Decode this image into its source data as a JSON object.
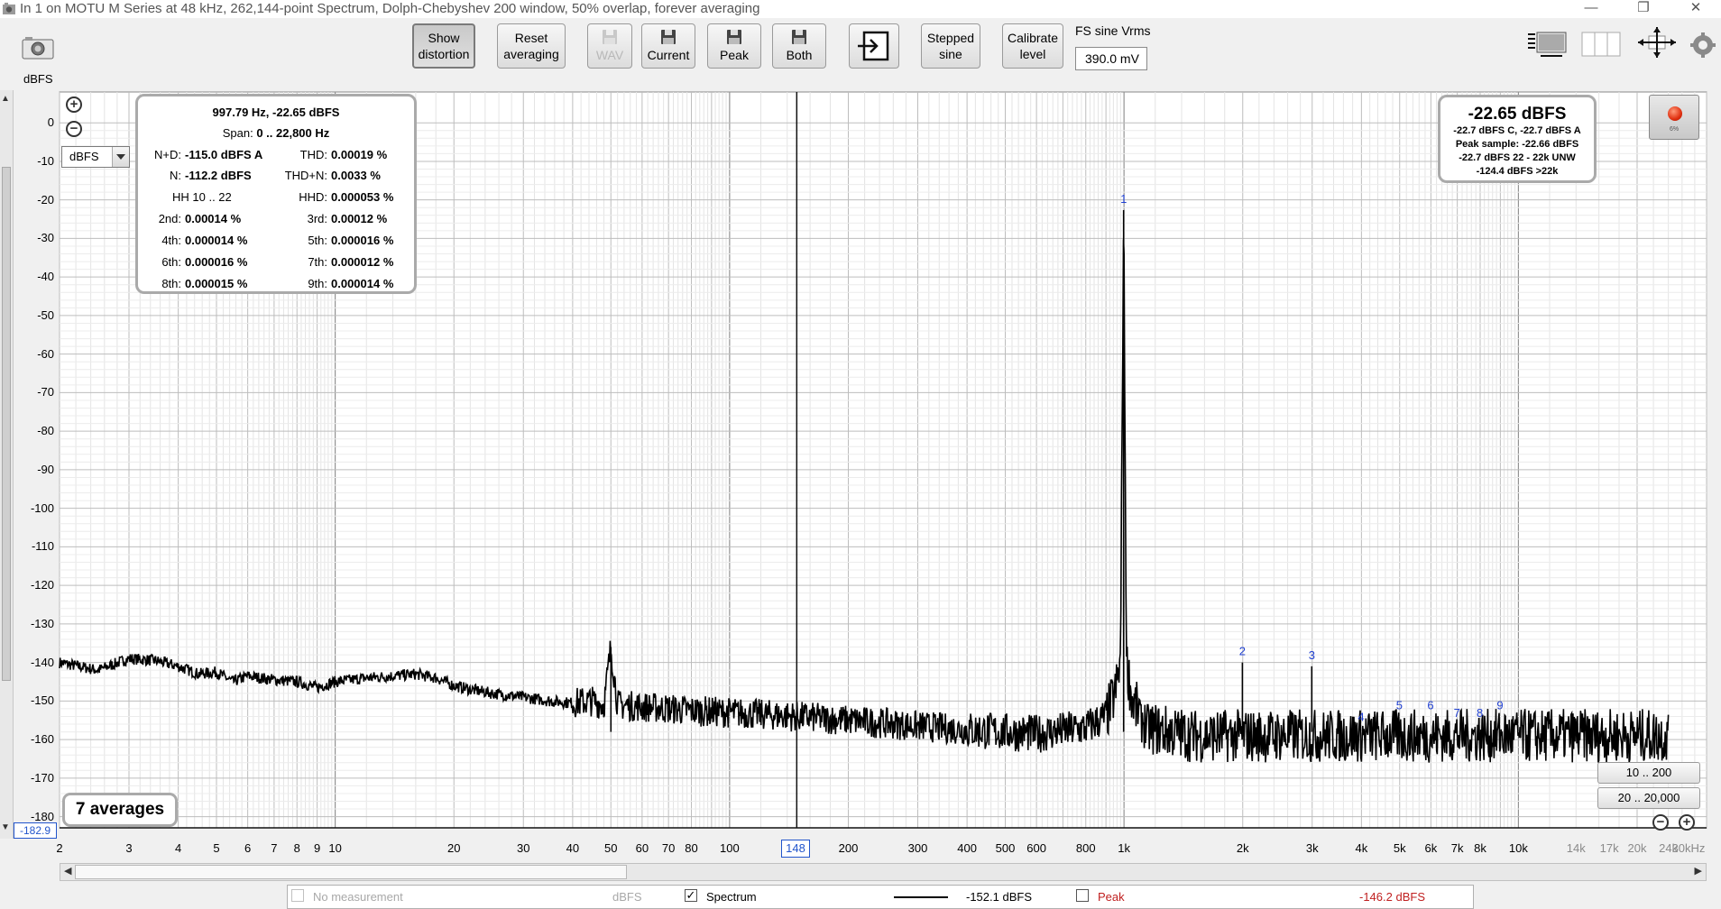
{
  "window": {
    "title": "In 1 on MOTU M Series at 48 kHz, 262,144-point Spectrum, Dolph-Chebyshev 200 window, 50% overlap, forever averaging",
    "icon": "app-icon",
    "minimize": "—",
    "restore": "❐",
    "close": "✕"
  },
  "toolbar": {
    "show_distortion": [
      "Show",
      "distortion"
    ],
    "reset_averaging": [
      "Reset",
      "averaging"
    ],
    "wav": "WAV",
    "current": "Current",
    "peak": "Peak",
    "both": "Both",
    "stepped_sine": [
      "Stepped",
      "sine"
    ],
    "calibrate_level": [
      "Calibrate",
      "level"
    ],
    "fs_label": "FS sine Vrms",
    "fs_value": "390.0 mV"
  },
  "left": {
    "y_unit": "dBFS",
    "unit_select": "dBFS",
    "y_readout": "-182.9"
  },
  "info": {
    "freq_level": "997.79 Hz, -22.65 dBFS",
    "span_label": "Span:",
    "span_value": "0 .. 22,800 Hz",
    "hh": "HH 10 .. 22",
    "rows": [
      {
        "l1": "N+D:",
        "v1": "-115.0 dBFS A",
        "l2": "THD:",
        "v2": "0.00019 %"
      },
      {
        "l1": "N:",
        "v1": "-112.2 dBFS",
        "l2": "THD+N:",
        "v2": "0.0033 %"
      },
      {
        "l1": "",
        "v1": "",
        "l2": "HHD:",
        "v2": "0.000053 %"
      },
      {
        "l1": "2nd:",
        "v1": "0.00014 %",
        "l2": "3rd:",
        "v2": "0.00012 %"
      },
      {
        "l1": "4th:",
        "v1": "0.000014 %",
        "l2": "5th:",
        "v2": "0.000016 %"
      },
      {
        "l1": "6th:",
        "v1": "0.000016 %",
        "l2": "7th:",
        "v2": "0.000012 %"
      },
      {
        "l1": "8th:",
        "v1": "0.000015 %",
        "l2": "9th:",
        "v2": "0.000014 %"
      }
    ]
  },
  "level": {
    "main": "-22.65 dBFS",
    "line1": "-22.7 dBFS C, -22.7 dBFS A",
    "line2": "Peak sample: -22.66 dBFS",
    "line3": "-22.7 dBFS 22 - 22k UNW",
    "line4": "-124.4 dBFS >22k",
    "rec_pct": "6%"
  },
  "averages": "7 averages",
  "range_buttons": [
    "10 .. 200",
    "20 .. 20,000"
  ],
  "cursor_label": "148",
  "legend": {
    "no_measurement": "No measurement",
    "unit": "dBFS",
    "spectrum": "Spectrum",
    "spectrum_value": "-152.1 dBFS",
    "peak": "Peak",
    "peak_value": "-146.2 dBFS",
    "spectrum_checked": "✓"
  },
  "chart_data": {
    "type": "line",
    "xscale": "log",
    "xlim": [
      2,
      30000
    ],
    "ylim": [
      -182.9,
      8
    ],
    "ylabel": "dBFS",
    "yticks": [
      0,
      -10,
      -20,
      -30,
      -40,
      -50,
      -60,
      -70,
      -80,
      -90,
      -100,
      -110,
      -120,
      -130,
      -140,
      -150,
      -160,
      -170,
      -180
    ],
    "xticks": [
      {
        "v": 2,
        "t": "2"
      },
      {
        "v": 3,
        "t": "3"
      },
      {
        "v": 4,
        "t": "4"
      },
      {
        "v": 5,
        "t": "5"
      },
      {
        "v": 6,
        "t": "6"
      },
      {
        "v": 7,
        "t": "7"
      },
      {
        "v": 8,
        "t": "8"
      },
      {
        "v": 9,
        "t": "9"
      },
      {
        "v": 10,
        "t": "10"
      },
      {
        "v": 20,
        "t": "20"
      },
      {
        "v": 30,
        "t": "30"
      },
      {
        "v": 40,
        "t": "40"
      },
      {
        "v": 50,
        "t": "50"
      },
      {
        "v": 60,
        "t": "60"
      },
      {
        "v": 70,
        "t": "70"
      },
      {
        "v": 80,
        "t": "80"
      },
      {
        "v": 100,
        "t": "100"
      },
      {
        "v": 200,
        "t": "200"
      },
      {
        "v": 300,
        "t": "300"
      },
      {
        "v": 400,
        "t": "400"
      },
      {
        "v": 500,
        "t": "500"
      },
      {
        "v": 600,
        "t": "600"
      },
      {
        "v": 800,
        "t": "800"
      },
      {
        "v": 1000,
        "t": "1k"
      },
      {
        "v": 2000,
        "t": "2k"
      },
      {
        "v": 3000,
        "t": "3k"
      },
      {
        "v": 4000,
        "t": "4k"
      },
      {
        "v": 5000,
        "t": "5k"
      },
      {
        "v": 6000,
        "t": "6k"
      },
      {
        "v": 7000,
        "t": "7k"
      },
      {
        "v": 8000,
        "t": "8k"
      },
      {
        "v": 10000,
        "t": "10k"
      }
    ],
    "xticks_grey": [
      {
        "v": 14000,
        "t": "14k"
      },
      {
        "v": 17000,
        "t": "17k"
      },
      {
        "v": 20000,
        "t": "20k"
      },
      {
        "v": 24000,
        "t": "24k"
      },
      {
        "v": 30000,
        "t": "30kHz"
      }
    ],
    "cursor_x": 148,
    "series": [
      {
        "name": "Spectrum",
        "color": "#000000",
        "points": [
          [
            2,
            -140
          ],
          [
            2.5,
            -142
          ],
          [
            3,
            -139
          ],
          [
            3.5,
            -139.5
          ],
          [
            4,
            -141
          ],
          [
            4.5,
            -143
          ],
          [
            5,
            -142.5
          ],
          [
            5.5,
            -145
          ],
          [
            6,
            -143.5
          ],
          [
            7,
            -144.5
          ],
          [
            8,
            -145
          ],
          [
            9,
            -146.5
          ],
          [
            10,
            -145
          ],
          [
            12,
            -144
          ],
          [
            14,
            -143.5
          ],
          [
            16,
            -143
          ],
          [
            18,
            -144
          ],
          [
            20,
            -146
          ],
          [
            22,
            -147
          ],
          [
            25,
            -148
          ],
          [
            30,
            -149
          ],
          [
            35,
            -150
          ],
          [
            40,
            -150.5
          ],
          [
            45,
            -150
          ],
          [
            48,
            -151
          ],
          [
            50,
            -136
          ],
          [
            52,
            -151
          ],
          [
            60,
            -151.5
          ],
          [
            70,
            -152
          ],
          [
            80,
            -152.5
          ],
          [
            100,
            -153
          ],
          [
            148,
            -154
          ],
          [
            200,
            -155
          ],
          [
            300,
            -156.5
          ],
          [
            400,
            -157.5
          ],
          [
            600,
            -158.5
          ],
          [
            800,
            -157
          ],
          [
            900,
            -154
          ],
          [
            950,
            -148
          ],
          [
            980,
            -140
          ],
          [
            997.8,
            -22.65
          ],
          [
            1015,
            -140
          ],
          [
            1050,
            -150
          ],
          [
            1150,
            -157
          ],
          [
            1500,
            -159
          ],
          [
            1995,
            -159
          ],
          [
            1996,
            -140
          ],
          [
            1997,
            -159
          ],
          [
            2990,
            -159
          ],
          [
            2993,
            -141
          ],
          [
            2996,
            -159
          ],
          [
            4000,
            -159
          ],
          [
            8000,
            -159
          ],
          [
            12000,
            -159
          ],
          [
            16000,
            -159
          ],
          [
            20000,
            -159
          ],
          [
            24000,
            -159
          ]
        ]
      }
    ],
    "harmonics": [
      {
        "n": "1",
        "f": 997.8,
        "db": -22.65
      },
      {
        "n": "2",
        "f": 1996,
        "db": -140
      },
      {
        "n": "3",
        "f": 2993,
        "db": -141
      },
      {
        "n": "4",
        "f": 3991,
        "db": -157
      },
      {
        "n": "5",
        "f": 4989,
        "db": -154
      },
      {
        "n": "6",
        "f": 5987,
        "db": -154
      },
      {
        "n": "7",
        "f": 6985,
        "db": -156
      },
      {
        "n": "8",
        "f": 7982,
        "db": -156
      },
      {
        "n": "9",
        "f": 8980,
        "db": -154
      }
    ]
  }
}
